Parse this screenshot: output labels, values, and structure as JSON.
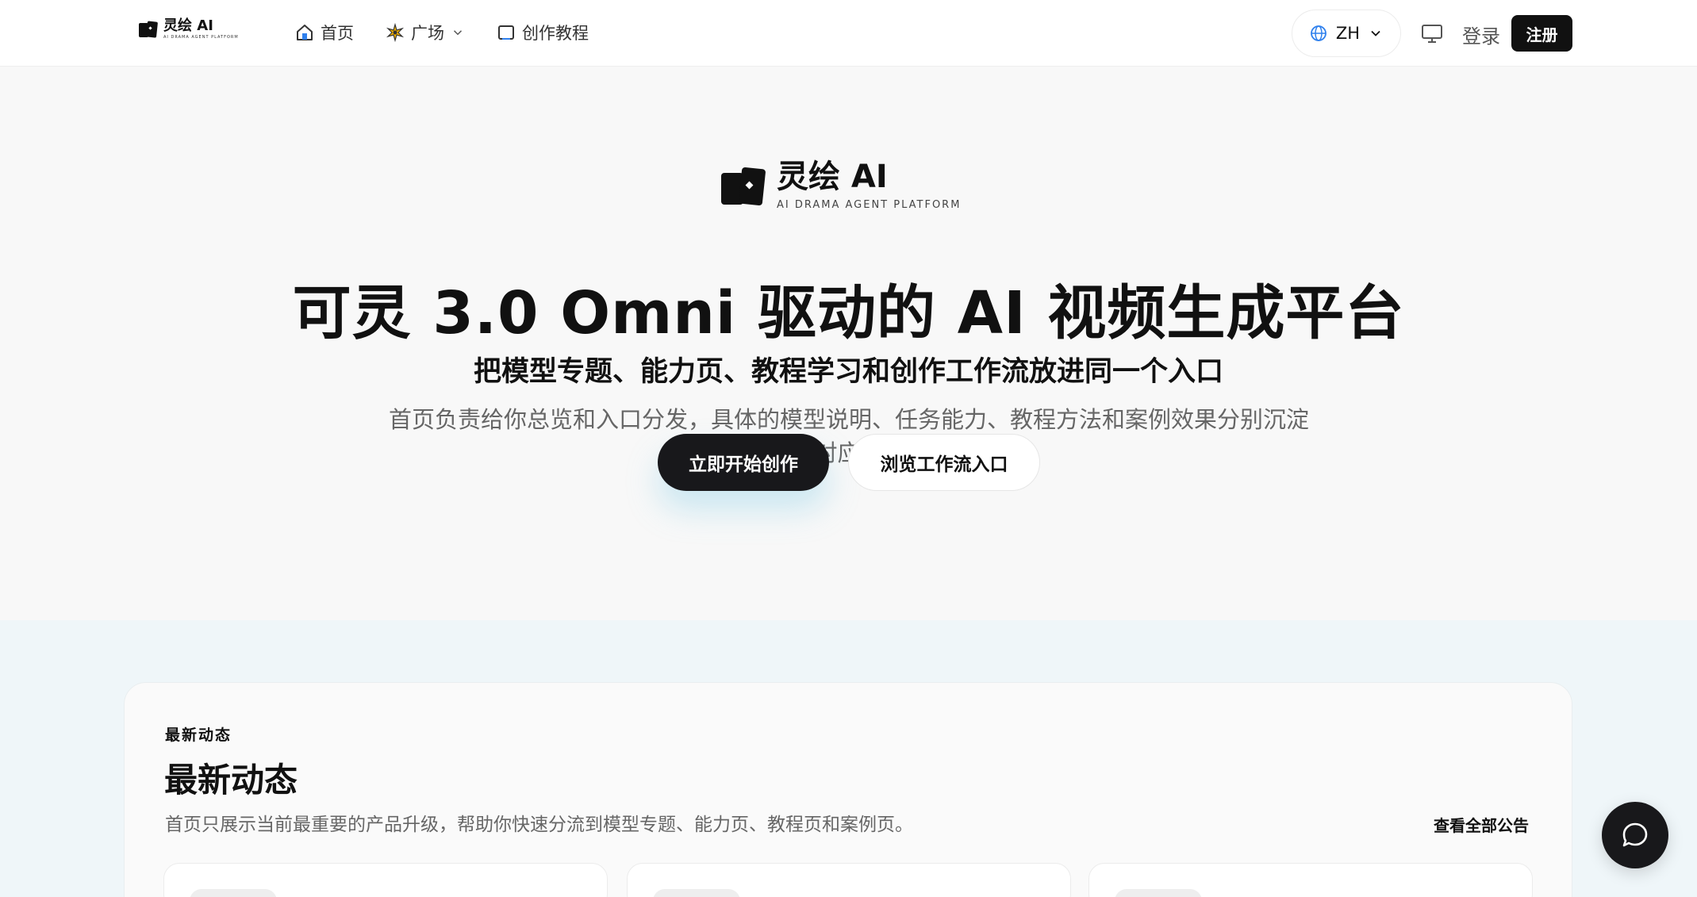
{
  "brand": {
    "name": "灵绘 AI",
    "tagline": "AI DRAMA AGENT PLATFORM"
  },
  "nav": {
    "home": "首页",
    "plaza": "广场",
    "tutorials": "创作教程"
  },
  "header": {
    "language": "ZH",
    "login": "登录",
    "register": "注册"
  },
  "hero": {
    "title": "可灵 3.0 Omni 驱动的 AI 视频生成平台",
    "subtitle": "把模型专题、能力页、教程学习和创作工作流放进同一个入口",
    "description": "首页负责给你总览和入口分发，具体的模型说明、任务能力、教程方法和案例效果分别沉淀到对应页面",
    "cta_primary": "立即开始创作",
    "cta_secondary": "浏览工作流入口"
  },
  "updates": {
    "eyebrow": "最新动态",
    "title": "最新动态",
    "description": "首页只展示当前最重要的产品升级，帮助你快速分流到模型专题、能力页、教程页和案例页。",
    "view_all": "查看全部公告"
  },
  "colors": {
    "primary": "#18181b",
    "hero_bg": "#f8f8f8",
    "section_bg": "#eff6f9",
    "globe": "#2f80ed"
  }
}
